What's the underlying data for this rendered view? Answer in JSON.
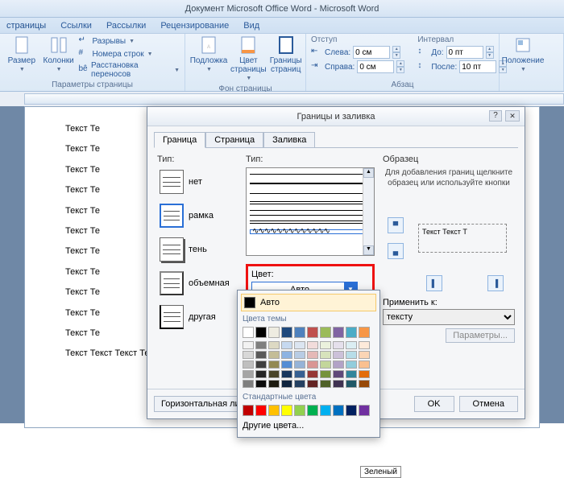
{
  "titlebar": "Документ Microsoft Office Word - Microsoft Word",
  "ribbon_tabs": [
    "страницы",
    "Ссылки",
    "Рассылки",
    "Рецензирование",
    "Вид"
  ],
  "ribbon": {
    "page_params": {
      "razmer": "Размер",
      "kolonki": "Колонки",
      "razryvy": "Разрывы",
      "nomera": "Номера строк",
      "perenos": "Расстановка переносов",
      "label": "Параметры страницы"
    },
    "bg": {
      "podlozhka": "Подложка",
      "cvet": "Цвет страницы",
      "granicy": "Границы страниц",
      "label": "Фон страницы"
    },
    "indent": {
      "head": "Отступ",
      "left_lbl": "Слева:",
      "left_val": "0 см",
      "right_lbl": "Справа:",
      "right_val": "0 см"
    },
    "interval": {
      "head": "Интервал",
      "before_lbl": "До:",
      "before_val": "0 пт",
      "after_lbl": "После:",
      "after_val": "10 пт"
    },
    "abzac_label": "Абзац",
    "position": "Положение"
  },
  "doc_text": "Текст Текст Текст Текст Текст Текст Текст Текст",
  "doc_text_short": "Текст Те",
  "dialog": {
    "title": "Границы и заливка",
    "tabs": [
      "Граница",
      "Страница",
      "Заливка"
    ],
    "type_label": "Тип:",
    "types": [
      "нет",
      "рамка",
      "тень",
      "объемная",
      "другая"
    ],
    "style_label": "Тип:",
    "color_label": "Цвет:",
    "color_value": "Авто",
    "preview_label": "Образец",
    "preview_hint": "Для добавления границ щелкните образец или используйте кнопки",
    "preview_sample": "Текст Текст Т",
    "apply_label": "Применить к:",
    "apply_value": "тексту",
    "params": "Параметры...",
    "hline": "Горизонтальная линия...",
    "ok": "OK",
    "cancel": "Отмена"
  },
  "color_popup": {
    "auto": "Авто",
    "theme": "Цвета темы",
    "standard": "Стандартные цвета",
    "other": "Другие цвета...",
    "tooltip": "Зеленый",
    "theme_colors_row1": [
      "#ffffff",
      "#000000",
      "#eeece1",
      "#1f497d",
      "#4f81bd",
      "#c0504d",
      "#9bbb59",
      "#8064a2",
      "#4bacc6",
      "#f79646"
    ],
    "theme_tints": [
      [
        "#f2f2f2",
        "#7f7f7f",
        "#ddd9c3",
        "#c6d9f0",
        "#dbe5f1",
        "#f2dcdb",
        "#ebf1dd",
        "#e5e0ec",
        "#dbeef3",
        "#fdeada"
      ],
      [
        "#d8d8d8",
        "#595959",
        "#c4bd97",
        "#8db3e2",
        "#b8cce4",
        "#e5b9b7",
        "#d7e3bc",
        "#ccc1d9",
        "#b7dde8",
        "#fbd5b5"
      ],
      [
        "#bfbfbf",
        "#3f3f3f",
        "#938953",
        "#548dd4",
        "#95b3d7",
        "#d99694",
        "#c3d69b",
        "#b2a2c7",
        "#92cddc",
        "#fac08f"
      ],
      [
        "#a5a5a5",
        "#262626",
        "#494429",
        "#17365d",
        "#366092",
        "#953734",
        "#76923c",
        "#5f497a",
        "#31859b",
        "#e36c09"
      ],
      [
        "#7f7f7f",
        "#0c0c0c",
        "#1d1b10",
        "#0f243e",
        "#244061",
        "#632423",
        "#4f6128",
        "#3f3151",
        "#205867",
        "#974806"
      ]
    ],
    "standard_colors": [
      "#c00000",
      "#ff0000",
      "#ffc000",
      "#ffff00",
      "#92d050",
      "#00b050",
      "#00b0f0",
      "#0070c0",
      "#002060",
      "#7030a0"
    ]
  }
}
